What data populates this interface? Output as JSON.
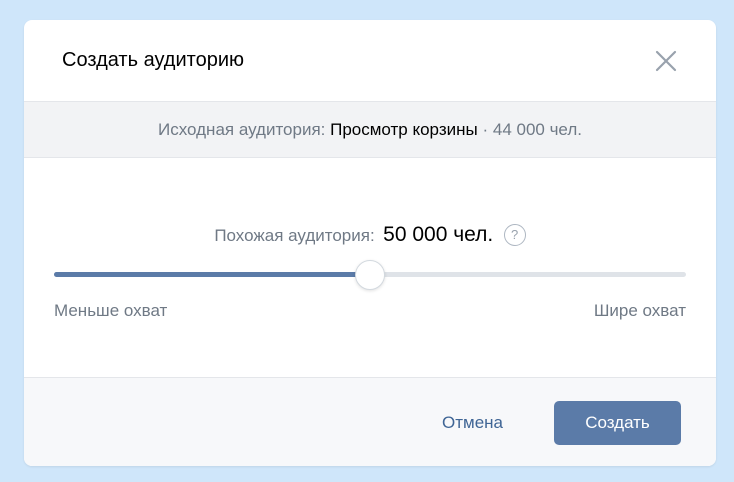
{
  "dialog": {
    "title": "Создать аудиторию"
  },
  "source": {
    "label": "Исходная аудитория:",
    "name": "Просмотр корзины",
    "separator": "·",
    "count": "44 000 чел."
  },
  "similar": {
    "label": "Похожая аудитория:",
    "value": "50 000 чел.",
    "help_glyph": "?"
  },
  "slider": {
    "level_fraction": 0.5,
    "min_label": "Меньше охват",
    "max_label": "Шире охват"
  },
  "footer": {
    "cancel_label": "Отмена",
    "create_label": "Создать"
  },
  "icons": {
    "close": "close-icon",
    "help": "help-icon"
  },
  "colors": {
    "accent": "#5b7ba8",
    "link": "#3f6595",
    "muted_text": "#6f7985",
    "background": "#cfe6fa"
  }
}
